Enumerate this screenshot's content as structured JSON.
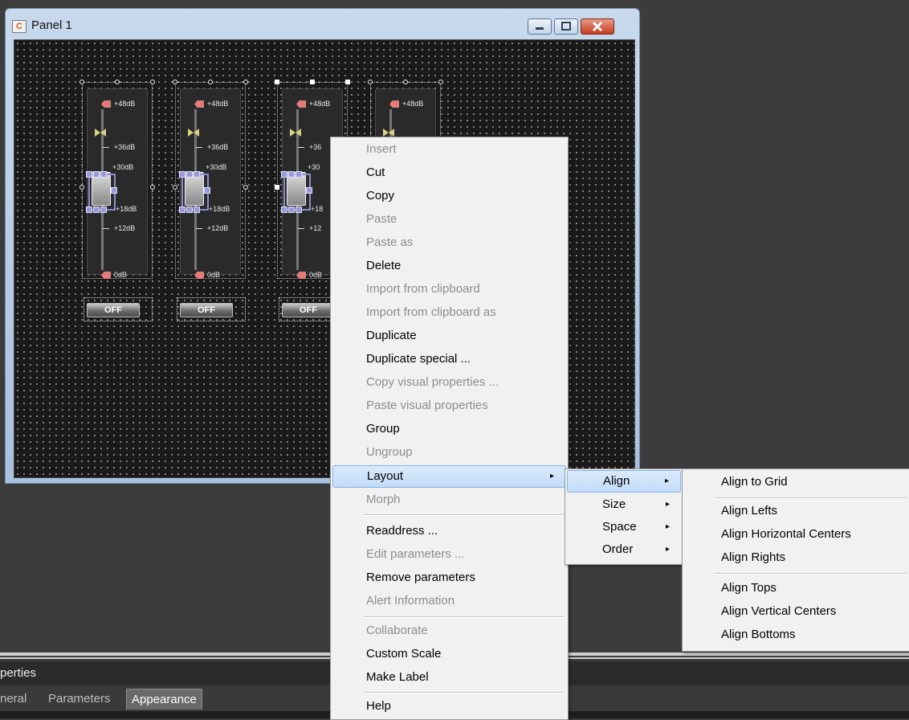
{
  "window": {
    "title": "Panel 1",
    "icon": "app-icon",
    "icon_glyph": "C"
  },
  "faders": [
    {
      "labels": {
        "db48": "+48dB",
        "db36": "+36dB",
        "db30": "+30dB",
        "db18": "+18dB",
        "db12": "+12dB",
        "db0": "0dB"
      },
      "button": "OFF"
    },
    {
      "labels": {
        "db48": "+48dB",
        "db36": "+36dB",
        "db30": "+30dB",
        "db18": "+18dB",
        "db12": "+12dB",
        "db0": "0dB"
      },
      "button": "OFF"
    },
    {
      "labels": {
        "db48": "+48dB",
        "db36": "+36",
        "db30": "+30",
        "db18": "+18",
        "db12": "+12",
        "db0": "0dB"
      },
      "button": "OFF"
    },
    {
      "labels": {
        "db48": "+48dB"
      }
    }
  ],
  "context_menu": {
    "items": [
      {
        "label": "Insert",
        "enabled": false
      },
      {
        "label": "Cut",
        "enabled": true
      },
      {
        "label": "Copy",
        "enabled": true
      },
      {
        "label": "Paste",
        "enabled": false
      },
      {
        "label": "Paste as",
        "enabled": false
      },
      {
        "label": "Delete",
        "enabled": true
      },
      {
        "label": "Import from clipboard",
        "enabled": false
      },
      {
        "label": "Import from clipboard as",
        "enabled": false
      },
      {
        "label": "Duplicate",
        "enabled": true
      },
      {
        "label": "Duplicate special ...",
        "enabled": true
      },
      {
        "label": "Copy visual properties ...",
        "enabled": false
      },
      {
        "label": "Paste visual properties",
        "enabled": false
      },
      {
        "label": "Group",
        "enabled": true
      },
      {
        "label": "Ungroup",
        "enabled": false
      },
      {
        "label": "Layout",
        "enabled": true,
        "submenu": true,
        "highlighted": true
      },
      {
        "label": "Morph",
        "enabled": false
      },
      {
        "label": "Readdress ...",
        "enabled": true
      },
      {
        "label": "Edit parameters ...",
        "enabled": false
      },
      {
        "label": "Remove parameters",
        "enabled": true
      },
      {
        "label": "Alert Information",
        "enabled": false
      },
      {
        "label": "Collaborate",
        "enabled": false
      },
      {
        "label": "Custom Scale",
        "enabled": true
      },
      {
        "label": "Make Label",
        "enabled": true
      },
      {
        "label": "Help",
        "enabled": true
      }
    ]
  },
  "layout_submenu": {
    "items": [
      {
        "label": "Align",
        "highlighted": true
      },
      {
        "label": "Size"
      },
      {
        "label": "Space"
      },
      {
        "label": "Order"
      }
    ]
  },
  "align_submenu": {
    "items": [
      {
        "label": "Align to Grid"
      },
      {
        "label": "Align Lefts"
      },
      {
        "label": "Align Horizontal Centers"
      },
      {
        "label": "Align Rights"
      },
      {
        "label": "Align Tops"
      },
      {
        "label": "Align Vertical Centers"
      },
      {
        "label": "Align Bottoms"
      }
    ]
  },
  "properties": {
    "header": "perties",
    "tabs": [
      {
        "label": "neral"
      },
      {
        "label": "Parameters"
      },
      {
        "label": "Appearance",
        "active": true
      }
    ]
  },
  "icons": {
    "submenu_arrow": "▸",
    "minimize": "minimize-icon",
    "maximize": "maximize-icon",
    "close": "close-icon"
  }
}
